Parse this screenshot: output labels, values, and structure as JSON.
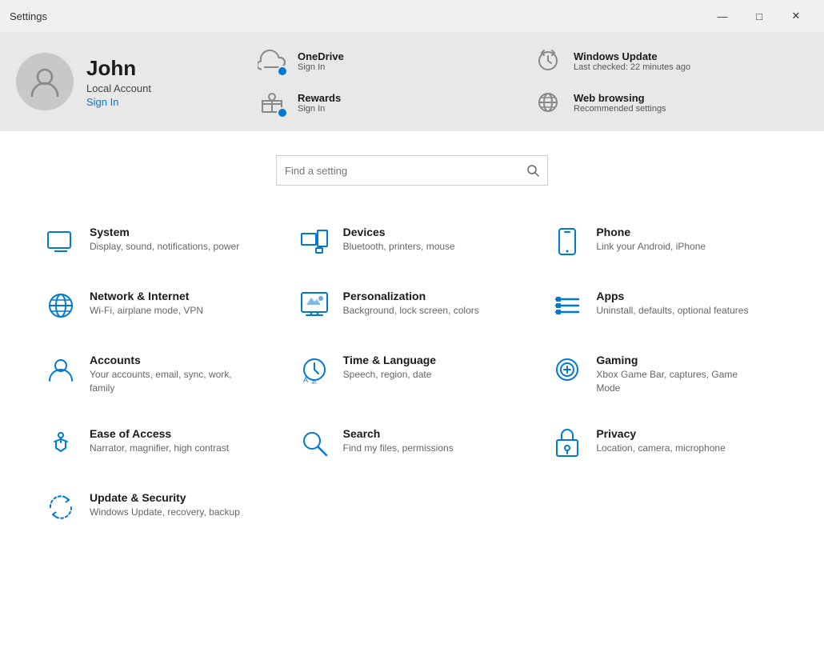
{
  "titlebar": {
    "title": "Settings",
    "minimize": "—",
    "maximize": "□",
    "close": "✕"
  },
  "header": {
    "user": {
      "name": "John",
      "account_type": "Local Account",
      "signin_label": "Sign In"
    },
    "services": [
      {
        "icon": "onedrive-icon",
        "title": "OneDrive",
        "subtitle": "Sign In",
        "has_dot": true
      },
      {
        "icon": "windows-update-icon",
        "title": "Windows Update",
        "subtitle": "Last checked: 22 minutes ago",
        "has_dot": false
      },
      {
        "icon": "rewards-icon",
        "title": "Rewards",
        "subtitle": "Sign In",
        "has_dot": true
      },
      {
        "icon": "web-browsing-icon",
        "title": "Web browsing",
        "subtitle": "Recommended settings",
        "has_dot": false
      }
    ]
  },
  "search": {
    "placeholder": "Find a setting"
  },
  "settings": [
    {
      "id": "system",
      "title": "System",
      "desc": "Display, sound, notifications, power",
      "icon": "system-icon"
    },
    {
      "id": "devices",
      "title": "Devices",
      "desc": "Bluetooth, printers, mouse",
      "icon": "devices-icon"
    },
    {
      "id": "phone",
      "title": "Phone",
      "desc": "Link your Android, iPhone",
      "icon": "phone-icon"
    },
    {
      "id": "network",
      "title": "Network & Internet",
      "desc": "Wi-Fi, airplane mode, VPN",
      "icon": "network-icon"
    },
    {
      "id": "personalization",
      "title": "Personalization",
      "desc": "Background, lock screen, colors",
      "icon": "personalization-icon"
    },
    {
      "id": "apps",
      "title": "Apps",
      "desc": "Uninstall, defaults, optional features",
      "icon": "apps-icon"
    },
    {
      "id": "accounts",
      "title": "Accounts",
      "desc": "Your accounts, email, sync, work, family",
      "icon": "accounts-icon"
    },
    {
      "id": "time",
      "title": "Time & Language",
      "desc": "Speech, region, date",
      "icon": "time-icon"
    },
    {
      "id": "gaming",
      "title": "Gaming",
      "desc": "Xbox Game Bar, captures, Game Mode",
      "icon": "gaming-icon"
    },
    {
      "id": "ease",
      "title": "Ease of Access",
      "desc": "Narrator, magnifier, high contrast",
      "icon": "ease-icon"
    },
    {
      "id": "search",
      "title": "Search",
      "desc": "Find my files, permissions",
      "icon": "search-settings-icon"
    },
    {
      "id": "privacy",
      "title": "Privacy",
      "desc": "Location, camera, microphone",
      "icon": "privacy-icon"
    },
    {
      "id": "update",
      "title": "Update & Security",
      "desc": "Windows Update, recovery, backup",
      "icon": "update-icon"
    }
  ]
}
